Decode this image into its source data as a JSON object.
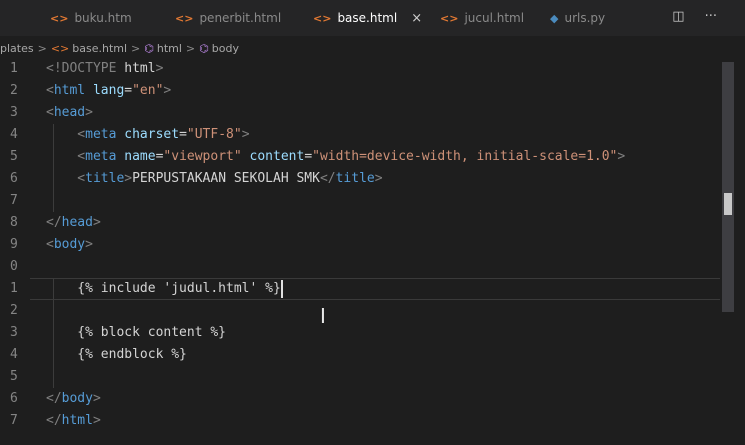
{
  "tabs": [
    {
      "label": "buku.htm",
      "icon": "<>",
      "active": false
    },
    {
      "label": "penerbit.html",
      "icon": "<>",
      "active": false
    },
    {
      "label": "base.html",
      "icon": "<>",
      "active": true,
      "close": "×"
    },
    {
      "label": "jucul.html",
      "icon": "<>",
      "active": false
    },
    {
      "label": "urls.py",
      "icon": "◆",
      "active": false
    }
  ],
  "tab_actions": {
    "split": "◫",
    "more": "···"
  },
  "breadcrumb": {
    "folder": "plates",
    "file": "base.html",
    "html": "html",
    "body": "body",
    "sep": ">",
    "file_icon": "<>",
    "element_icon": "⌬"
  },
  "editor": {
    "line_numbers": [
      "1",
      "2",
      "3",
      "4",
      "5",
      "6",
      "7",
      "8",
      "9",
      "0",
      "1",
      "2",
      "3",
      "4",
      "5",
      "6",
      "7"
    ],
    "lines": [
      [
        {
          "t": "<!DOCTYPE ",
          "c": "angle"
        },
        {
          "t": "html",
          "c": "text"
        },
        {
          "t": ">",
          "c": "angle"
        }
      ],
      [
        {
          "t": "<",
          "c": "angle"
        },
        {
          "t": "html ",
          "c": "tag"
        },
        {
          "t": "lang",
          "c": "attr"
        },
        {
          "t": "=",
          "c": "text"
        },
        {
          "t": "\"en\"",
          "c": "str"
        },
        {
          "t": ">",
          "c": "angle"
        }
      ],
      [
        {
          "t": "<",
          "c": "angle"
        },
        {
          "t": "head",
          "c": "tag"
        },
        {
          "t": ">",
          "c": "angle"
        }
      ],
      [
        {
          "t": "    <",
          "c": "angle"
        },
        {
          "t": "meta ",
          "c": "tag"
        },
        {
          "t": "charset",
          "c": "attr"
        },
        {
          "t": "=",
          "c": "text"
        },
        {
          "t": "\"UTF-8\"",
          "c": "str"
        },
        {
          "t": ">",
          "c": "angle"
        }
      ],
      [
        {
          "t": "    <",
          "c": "angle"
        },
        {
          "t": "meta ",
          "c": "tag"
        },
        {
          "t": "name",
          "c": "attr"
        },
        {
          "t": "=",
          "c": "text"
        },
        {
          "t": "\"viewport\" ",
          "c": "str"
        },
        {
          "t": "content",
          "c": "attr"
        },
        {
          "t": "=",
          "c": "text"
        },
        {
          "t": "\"width=device-width, initial-scale=1.0\"",
          "c": "str"
        },
        {
          "t": ">",
          "c": "angle"
        }
      ],
      [
        {
          "t": "    <",
          "c": "angle"
        },
        {
          "t": "title",
          "c": "tag"
        },
        {
          "t": ">",
          "c": "angle"
        },
        {
          "t": "PERPUSTAKAAN SEKOLAH SMK",
          "c": "text"
        },
        {
          "t": "</",
          "c": "angle"
        },
        {
          "t": "title",
          "c": "tag"
        },
        {
          "t": ">",
          "c": "angle"
        }
      ],
      [],
      [
        {
          "t": "</",
          "c": "angle"
        },
        {
          "t": "head",
          "c": "tag"
        },
        {
          "t": ">",
          "c": "angle"
        }
      ],
      [
        {
          "t": "<",
          "c": "angle"
        },
        {
          "t": "body",
          "c": "tag"
        },
        {
          "t": ">",
          "c": "angle"
        }
      ],
      [],
      [
        {
          "t": "    {% include 'judul.html' %}",
          "c": "tpl"
        }
      ],
      [],
      [
        {
          "t": "    {% block content %}",
          "c": "tpl"
        }
      ],
      [
        {
          "t": "    {% endblock %}",
          "c": "tpl"
        }
      ],
      [],
      [
        {
          "t": "</",
          "c": "angle"
        },
        {
          "t": "body",
          "c": "tag"
        },
        {
          "t": ">",
          "c": "angle"
        }
      ],
      [
        {
          "t": "</",
          "c": "angle"
        },
        {
          "t": "html",
          "c": "tag"
        },
        {
          "t": ">",
          "c": "angle"
        }
      ]
    ],
    "current_line_index": 10,
    "ibeam": "I"
  },
  "colors": {
    "background": "#1e1e1e",
    "tag": "#569cd6",
    "attr": "#9cdcfe",
    "string": "#ce9178"
  }
}
